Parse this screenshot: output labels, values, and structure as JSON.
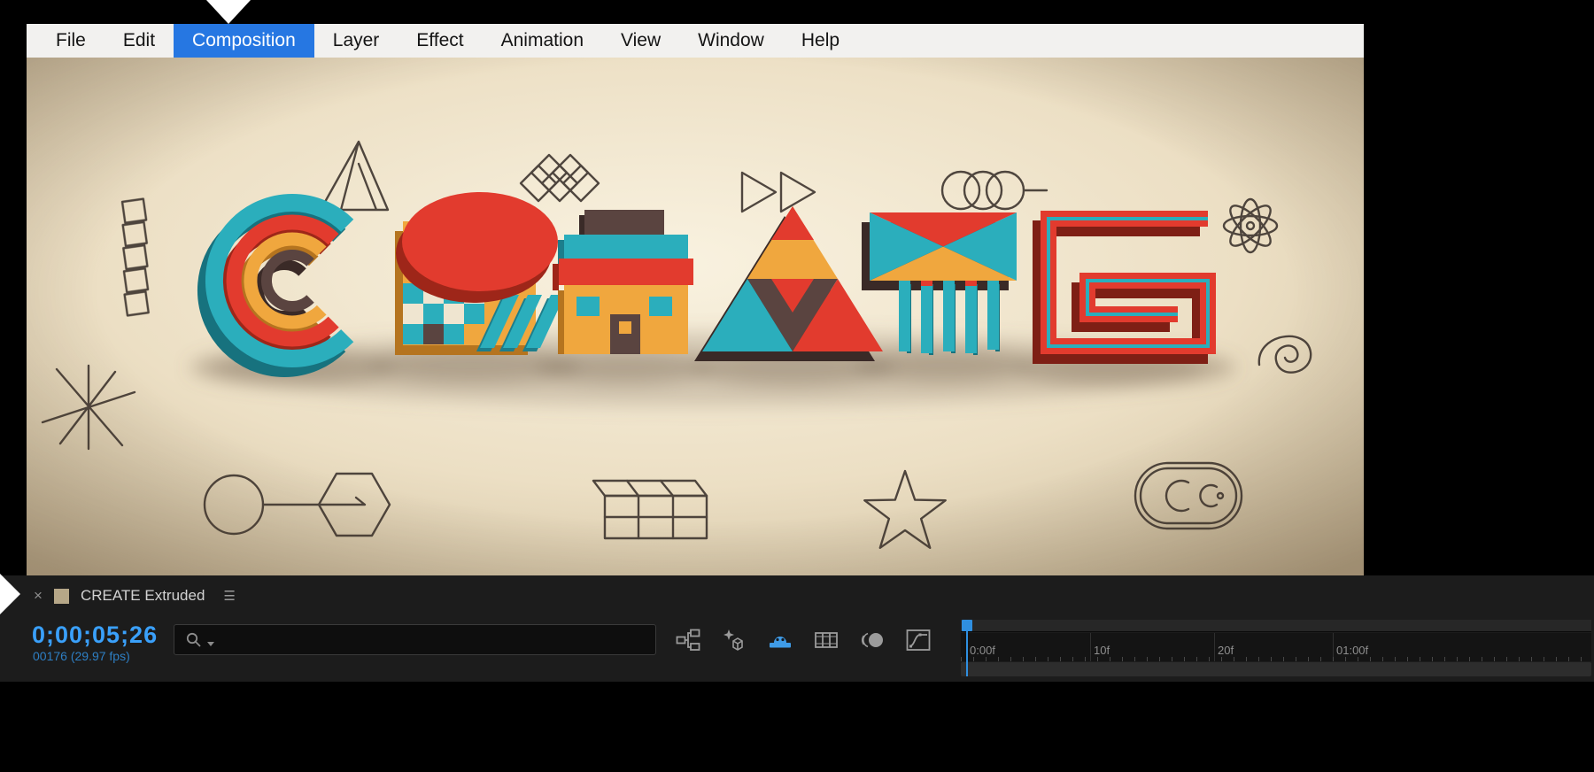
{
  "menu_bar": {
    "items": [
      {
        "label": "File",
        "active": false
      },
      {
        "label": "Edit",
        "active": false
      },
      {
        "label": "Composition",
        "active": true
      },
      {
        "label": "Layer",
        "active": false
      },
      {
        "label": "Effect",
        "active": false
      },
      {
        "label": "Animation",
        "active": false
      },
      {
        "label": "View",
        "active": false
      },
      {
        "label": "Window",
        "active": false
      },
      {
        "label": "Help",
        "active": false
      }
    ],
    "active_bg": "#2677e2"
  },
  "composition": {
    "artwork_word": "CREATE",
    "palette": {
      "teal": "#2BAEBC",
      "red": "#E23B2E",
      "orange": "#F0A73E",
      "brown": "#5A4440",
      "canvas": "#EDE2C7"
    }
  },
  "timeline": {
    "tab": {
      "close_label": "×",
      "title": "CREATE Extruded",
      "menu_glyph": "☰"
    },
    "timecode": "0;00;05;26",
    "frame_info": "00176 (29.97 fps)",
    "search": {
      "placeholder": "",
      "icon": "search-icon"
    },
    "icons": [
      {
        "name": "mini-flowchart-icon"
      },
      {
        "name": "draft-3d-icon"
      },
      {
        "name": "shy-layers-icon",
        "active_color": "#3f9ce8"
      },
      {
        "name": "frame-blending-icon"
      },
      {
        "name": "motion-blur-icon"
      },
      {
        "name": "graph-editor-icon"
      }
    ],
    "ruler_labels": [
      "0:00f",
      "10f",
      "20f",
      "01:00f"
    ],
    "playhead_color": "#2f8fe0",
    "timecode_color": "#3aa0fa"
  },
  "indicators": {
    "top_pointer": "down-arrow-icon",
    "left_pointer": "right-arrow-icon"
  }
}
